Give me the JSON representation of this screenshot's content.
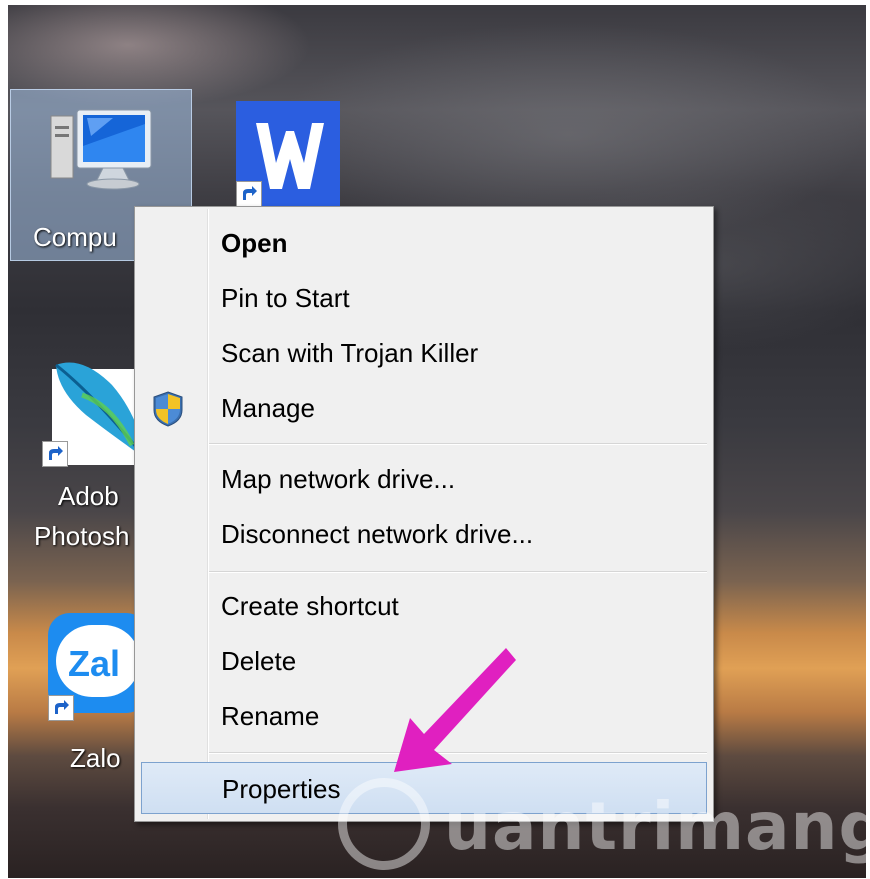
{
  "desktop": {
    "icons": [
      {
        "label": "Compu"
      },
      {
        "label": ""
      },
      {
        "label_line1": "Adob",
        "label_line2": "Photosh"
      },
      {
        "label": "Zalo"
      }
    ],
    "zalo_icon_text": "Zal"
  },
  "context_menu": {
    "items": [
      {
        "label": "Open"
      },
      {
        "label": "Pin to Start"
      },
      {
        "label": "Scan with Trojan Killer"
      },
      {
        "label": "Manage",
        "icon": "uac-shield-icon"
      },
      {
        "label": "Map network drive..."
      },
      {
        "label": "Disconnect network drive..."
      },
      {
        "label": "Create shortcut"
      },
      {
        "label": "Delete"
      },
      {
        "label": "Rename"
      },
      {
        "label": "Properties"
      }
    ],
    "highlighted_item": "Properties"
  },
  "watermark": {
    "text": "uantrimang"
  },
  "colors": {
    "menu_bg": "#f0f0f0",
    "highlight": "#cfdff2",
    "arrow": "#e020c0",
    "word_blue": "#2b5ee0"
  }
}
